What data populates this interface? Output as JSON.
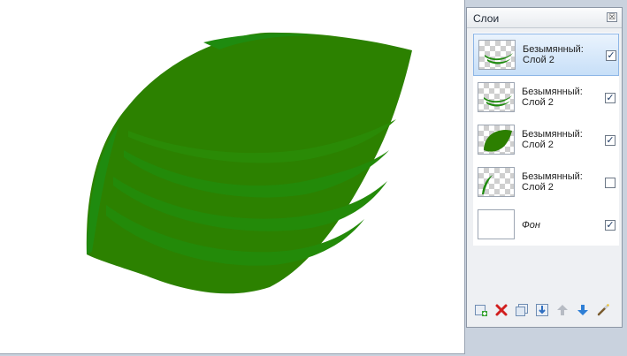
{
  "layers_panel": {
    "title": "Слои",
    "close_glyph": "☒",
    "layers": [
      {
        "name": "Безымянный: Слой 2",
        "line1": "Безымянный:",
        "line2": "Слой 2",
        "visible": true,
        "selected": true,
        "thumb": "leaf-veins-icon"
      },
      {
        "name": "Безымянный: Слой 2",
        "line1": "Безымянный:",
        "line2": "Слой 2",
        "visible": true,
        "selected": false,
        "thumb": "leaf-veins-icon"
      },
      {
        "name": "Безымянный: Слой 2",
        "line1": "Безымянный:",
        "line2": "Слой 2",
        "visible": true,
        "selected": false,
        "thumb": "leaf-icon"
      },
      {
        "name": "Безымянный: Слой 2",
        "line1": "Безымянный:",
        "line2": "Слой 2",
        "visible": false,
        "selected": false,
        "thumb": "leaf-edge-icon"
      },
      {
        "name": "Фон",
        "line1": "Фон",
        "line2": "",
        "visible": true,
        "selected": false,
        "thumb": "white-background"
      }
    ],
    "check_glyph": "✓",
    "toolbar": [
      "add-layer-icon",
      "delete-layer-icon",
      "duplicate-layer-icon",
      "merge-down-icon",
      "move-up-icon",
      "move-down-icon",
      "layer-properties-icon"
    ]
  },
  "colors": {
    "leaf_main": "#2c8100",
    "leaf_vein": "#238a09",
    "leaf_edge": "#1f8b0f",
    "selection": "#c7dff8"
  }
}
